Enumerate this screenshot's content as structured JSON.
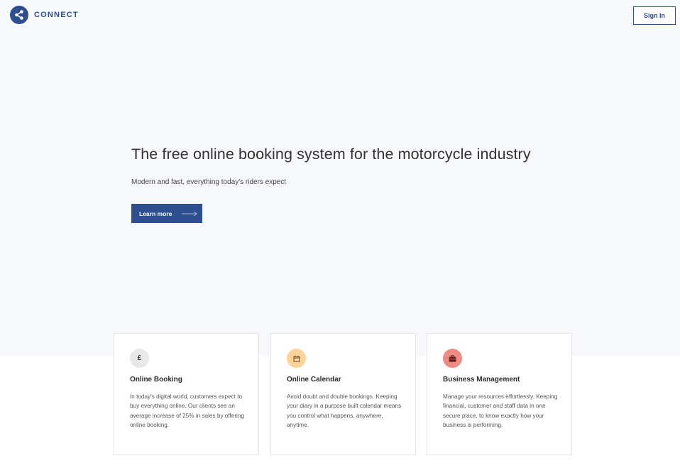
{
  "header": {
    "brand": "CONNECT",
    "sign_in_label": "Sign In"
  },
  "hero": {
    "title": "The free online booking system for the motorcycle industry",
    "subtitle": "Modern and fast, everything today's riders expect",
    "cta_label": "Learn more"
  },
  "features": [
    {
      "icon": "pound-icon",
      "icon_glyph": "£",
      "icon_bg": "#e8e8ea",
      "icon_color": "#333333",
      "title": "Online Booking",
      "text": "In today's digital world, customers expect to buy everything online. Our clients see an average increase of 25% in sales by offering online booking."
    },
    {
      "icon": "calendar-icon",
      "icon_bg": "#fbd39b",
      "icon_color": "#6b4a1a",
      "title": "Online Calendar",
      "text": "Avoid doubt and double bookings. Keeping your diary in a purpose built calendar means you control what happens, anywhere, anytime."
    },
    {
      "icon": "briefcase-icon",
      "icon_bg": "#f08a85",
      "icon_color": "#5a1e1c",
      "title": "Business Management",
      "text": "Manage your resources effortlessly. Keeping financial, customer and staff data in one secure place, to know exactly how your business is performing."
    }
  ],
  "colors": {
    "brand": "#2d4e8f",
    "hero_background": "#f7f8fb"
  }
}
